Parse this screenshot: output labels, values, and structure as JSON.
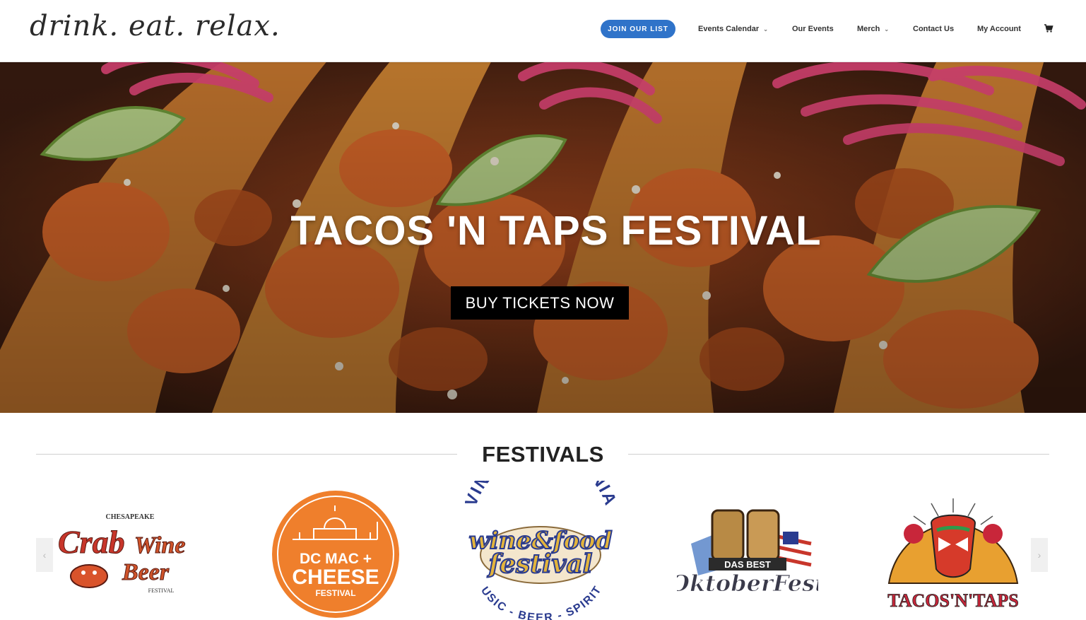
{
  "header": {
    "logo_text": "drink. eat. relax.",
    "join_label": "JOIN OUR LIST",
    "nav": [
      {
        "label": "Events Calendar"
      },
      {
        "label": "Our Events"
      },
      {
        "label": "Merch"
      },
      {
        "label": "Contact Us"
      },
      {
        "label": "My Account"
      }
    ],
    "cart_icon": "shopping-cart-icon"
  },
  "hero": {
    "title": "TACOS 'N TAPS FESTIVAL",
    "button_label": "BUY TICKETS NOW"
  },
  "festivals": {
    "heading": "FESTIVALS",
    "prev_icon": "chevron-left-icon",
    "next_icon": "chevron-right-icon",
    "prev_glyph": "‹",
    "next_glyph": "›",
    "items": [
      {
        "lines": [
          "CHESAPEAKE",
          "Crab",
          "Wine",
          "Beer",
          "FESTIVAL"
        ]
      },
      {
        "lines": [
          "DC MAC +",
          "CHEESE",
          "FESTIVAL"
        ]
      },
      {
        "lines": [
          "VINTAGE VIRGINIA",
          "wine&food",
          "festival",
          "MUSIC - BEER - SPIRITS"
        ]
      },
      {
        "lines": [
          "DAS BEST",
          "OktoberFest"
        ]
      },
      {
        "lines": [
          "TACOS'N'TAPS"
        ]
      }
    ]
  },
  "colors": {
    "join_button": "#2f73c9",
    "dc_orange": "#ef7f2c",
    "virginia_blue": "#2a3b8f",
    "crab_red": "#c8362b"
  }
}
